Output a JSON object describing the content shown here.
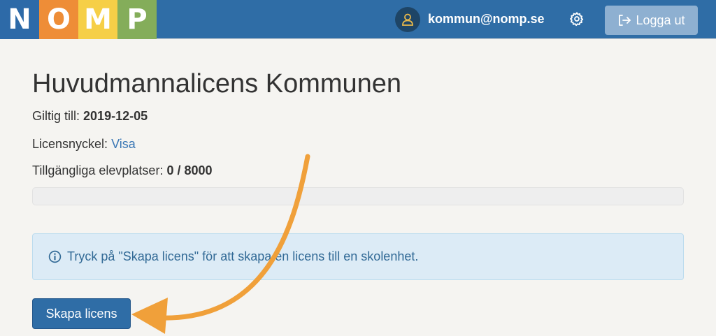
{
  "logo": {
    "letters": [
      {
        "char": "N",
        "color": "#2d6aa8"
      },
      {
        "char": "O",
        "color": "#ee8d37"
      },
      {
        "char": "M",
        "color": "#f6cf47"
      },
      {
        "char": "P",
        "color": "#84ad5a"
      }
    ]
  },
  "header": {
    "user_email": "kommun@nomp.se",
    "logout_label": "Logga ut"
  },
  "license": {
    "title": "Huvudmannalicens Kommunen",
    "valid_label": "Giltig till:",
    "valid_date": "2019-12-05",
    "key_label": "Licensnyckel:",
    "key_link": "Visa",
    "seats_label": "Tillgängliga elevplatser:",
    "seats_value": "0 / 8000",
    "seats_used_fraction": 0
  },
  "alert": {
    "text": "Tryck på \"Skapa licens\" för att skapa en licens till en skolenhet."
  },
  "actions": {
    "create_label": "Skapa licens"
  },
  "colors": {
    "navbar": "#2f6da6",
    "annotation_arrow": "#f0a03a"
  }
}
